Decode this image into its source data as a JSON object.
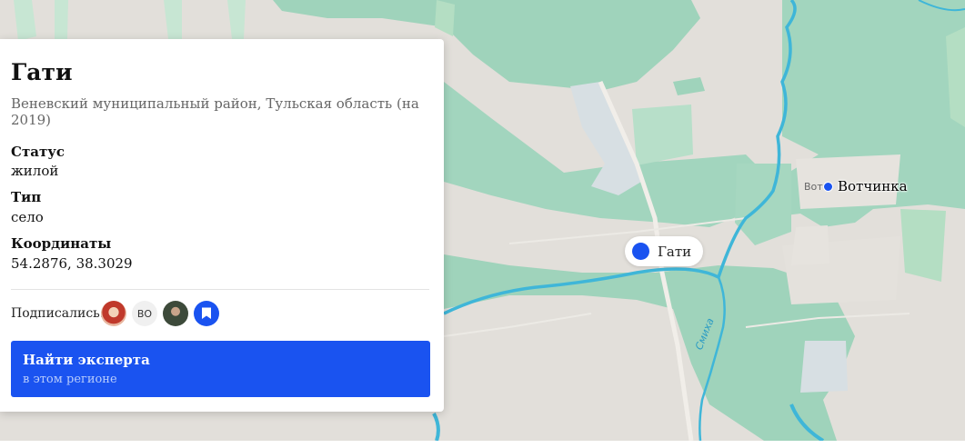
{
  "place": {
    "title": "Гати",
    "subtitle": "Веневский муниципальный район, Тульская область (на 2019)",
    "fields": [
      {
        "label": "Статус",
        "value": "жилой"
      },
      {
        "label": "Тип",
        "value": "село"
      },
      {
        "label": "Координаты",
        "value": "54.2876, 38.3029"
      }
    ]
  },
  "subscribers": {
    "label": "Подписались:",
    "avatars": [
      {
        "name": "avatar-photo",
        "initials": ""
      },
      {
        "name": "avatar-initials",
        "initials": "ВО"
      },
      {
        "name": "avatar-photo",
        "initials": ""
      }
    ]
  },
  "expert_button": {
    "title": "Найти эксперта",
    "subtitle": "в этом регионе"
  },
  "map": {
    "selected_marker_label": "Гати",
    "nearby_marker_label": "Вотчинка",
    "basemap_settlement_label": "Вот",
    "river_label": "Смиха"
  },
  "colors": {
    "accent": "#1a53f0",
    "forest": "#9fd3bb",
    "field": "#e2dfda",
    "water": "#3fb6d8"
  }
}
